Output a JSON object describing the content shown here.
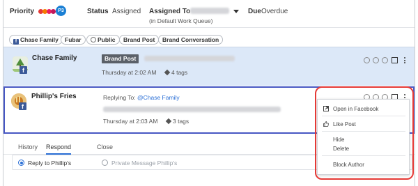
{
  "header": {
    "priority_label": "Priority",
    "priority_badge": "P3",
    "priority_colors": [
      "#e53935",
      "#f57c00",
      "#e91e63",
      "#c2185b"
    ],
    "status_label": "Status",
    "status_value": "Assigned",
    "assigned_label": "Assigned To",
    "assigned_sub": "(in Default Work Queue)",
    "due_label": "Due",
    "due_value": "Overdue"
  },
  "tags": {
    "items": [
      {
        "label": "Chase Family",
        "icon": "facebook-icon"
      },
      {
        "label": "Fubar",
        "icon": ""
      },
      {
        "label": "Public",
        "icon": "globe-icon"
      },
      {
        "label": "Brand Post",
        "icon": ""
      },
      {
        "label": "Brand Conversation",
        "icon": ""
      }
    ]
  },
  "posts": [
    {
      "author": "Chase Family",
      "badge": "Brand Post",
      "time": "Thursday at 2:02 AM",
      "tags": "4 tags"
    },
    {
      "author": "Phillip's Fries",
      "reply_prefix": "Replying To:",
      "reply_to": "@Chase Family",
      "time": "Thursday at 2:03 AM",
      "tags": "3 tags"
    }
  ],
  "tabs": [
    {
      "label": "History"
    },
    {
      "label": "Respond"
    },
    {
      "label": "Close"
    }
  ],
  "respond": {
    "reply_option": "Reply to Phillip's",
    "private_option": "Private Message Phillip's"
  },
  "menu": {
    "open_in_facebook": "Open in Facebook",
    "like_post": "Like Post",
    "hide": "Hide",
    "delete": "Delete",
    "block_author": "Block Author"
  },
  "colors": {
    "accent": "#2a6fd6",
    "selected_border": "#4757c3",
    "highlight": "#e53935",
    "row_bg": "#dce8f8",
    "facebook": "#3b5998"
  }
}
